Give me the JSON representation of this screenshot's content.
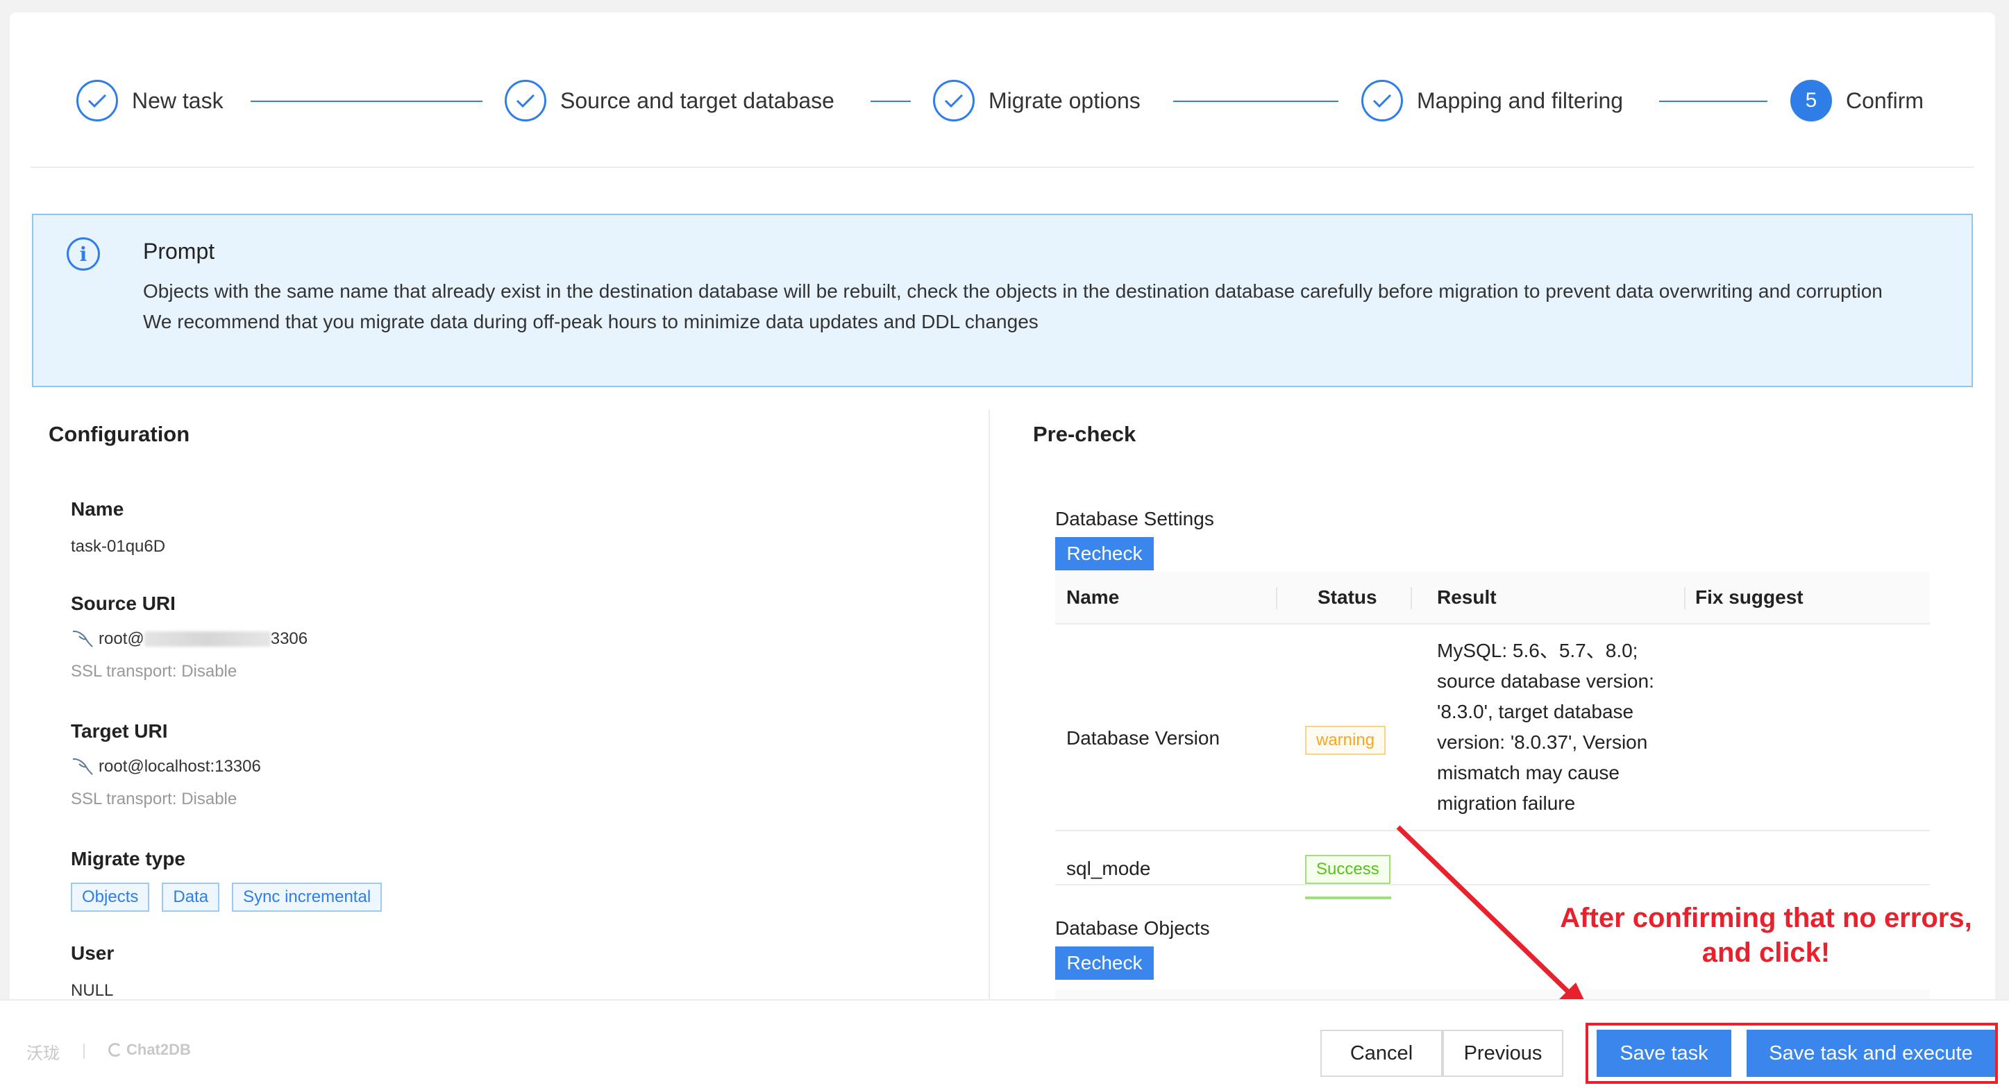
{
  "steps": [
    {
      "label": "New task",
      "state": "done"
    },
    {
      "label": "Source and target database",
      "state": "done"
    },
    {
      "label": "Migrate options",
      "state": "done"
    },
    {
      "label": "Mapping and filtering",
      "state": "done"
    },
    {
      "label": "Confirm",
      "state": "current",
      "number": "5"
    }
  ],
  "prompt": {
    "title": "Prompt",
    "line1": "Objects with the same name that already exist in the destination database will be rebuilt, check the objects in the destination database carefully before migration to prevent data overwriting and corruption",
    "line2": "We recommend that you migrate data during off-peak hours to minimize data updates and DDL changes"
  },
  "configuration": {
    "title": "Configuration",
    "name_label": "Name",
    "name_value": "task-01qu6D",
    "source_label": "Source URI",
    "source_prefix": "root@",
    "source_suffix": "3306",
    "source_ssl": "SSL transport: Disable",
    "target_label": "Target URI",
    "target_value": "root@localhost:13306",
    "target_ssl": "SSL transport: Disable",
    "migrate_type_label": "Migrate type",
    "migrate_types": [
      "Objects",
      "Data",
      "Sync incremental"
    ],
    "user_label": "User",
    "user_value": "NULL"
  },
  "precheck": {
    "title": "Pre-check",
    "settings_label": "Database Settings",
    "objects_label": "Database Objects",
    "recheck_label": "Recheck",
    "columns": [
      "Name",
      "Status",
      "Result",
      "Fix suggest"
    ],
    "rows": [
      {
        "name": "Database Version",
        "status": "warning",
        "result_lines": [
          "MySQL: 5.6、5.7、8.0;",
          "source database version:",
          "'8.3.0', target database",
          "version: '8.0.37', Version",
          "mismatch may cause",
          "migration failure"
        ]
      },
      {
        "name": "sql_mode",
        "status": "Success",
        "result_lines": []
      }
    ]
  },
  "annotation": {
    "line1": "After confirming that no errors,",
    "line2": "and click!"
  },
  "footer": {
    "logo1": "沃珑",
    "logo2": "Chat2DB",
    "cancel": "Cancel",
    "previous": "Previous",
    "save": "Save task",
    "save_execute": "Save task and execute"
  },
  "colors": {
    "accent": "#2f7ee8",
    "annotation": "#e8212d",
    "warning": "#f5a623",
    "success": "#52c41a"
  }
}
